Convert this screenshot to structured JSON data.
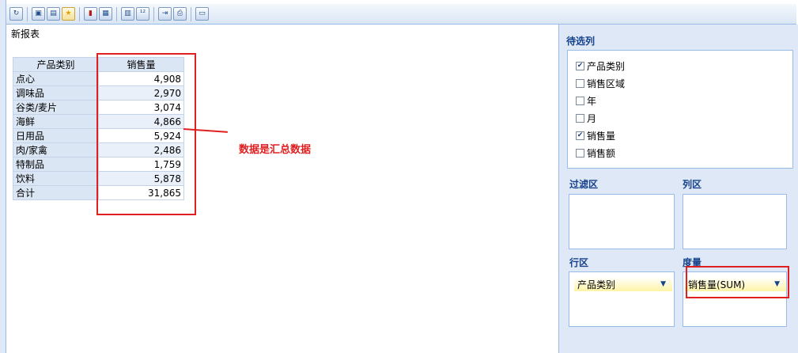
{
  "toolbar": {
    "buttons": [
      {
        "name": "refresh-icon",
        "glyph": "↻"
      },
      {
        "name": "save-icon",
        "glyph": "▣"
      },
      {
        "name": "save-as-icon",
        "glyph": "▤"
      },
      {
        "name": "favorite-icon",
        "glyph": "★"
      },
      {
        "name": "chart-icon",
        "glyph": "▮"
      },
      {
        "name": "window-icon",
        "glyph": "▦"
      },
      {
        "name": "preview-icon",
        "glyph": "▥"
      },
      {
        "name": "format-icon",
        "glyph": "¹²"
      },
      {
        "name": "export-icon",
        "glyph": "⇥"
      },
      {
        "name": "print-icon",
        "glyph": "⎙"
      },
      {
        "name": "page-icon",
        "glyph": "▭"
      }
    ]
  },
  "report": {
    "title": "新报表",
    "headers": [
      "产品类别",
      "销售量"
    ],
    "rows": [
      {
        "category": "点心",
        "value": "4,908"
      },
      {
        "category": "调味品",
        "value": "2,970"
      },
      {
        "category": "谷类/麦片",
        "value": "3,074"
      },
      {
        "category": "海鲜",
        "value": "4,866"
      },
      {
        "category": "日用品",
        "value": "5,924"
      },
      {
        "category": "肉/家禽",
        "value": "2,486"
      },
      {
        "category": "特制品",
        "value": "1,759"
      },
      {
        "category": "饮料",
        "value": "5,878"
      },
      {
        "category": "合计",
        "value": "31,865"
      }
    ]
  },
  "annotation": {
    "text": "数据是汇总数据",
    "color": "#e02020"
  },
  "panel": {
    "candidates_title": "待选列",
    "fields": [
      {
        "label": "产品类别",
        "checked": true
      },
      {
        "label": "销售区域",
        "checked": false
      },
      {
        "label": "年",
        "checked": false
      },
      {
        "label": "月",
        "checked": false
      },
      {
        "label": "销售量",
        "checked": true
      },
      {
        "label": "销售额",
        "checked": false
      }
    ],
    "filter_title": "过滤区",
    "column_title": "列区",
    "row_title": "行区",
    "measure_title": "度量",
    "row_item": "产品类别",
    "measure_item": "销售量(SUM)"
  },
  "colors": {
    "accent": "#15428b",
    "panel_bg": "#dfe8f6",
    "highlight": "#fdf4a6",
    "annotation": "#e02020"
  }
}
